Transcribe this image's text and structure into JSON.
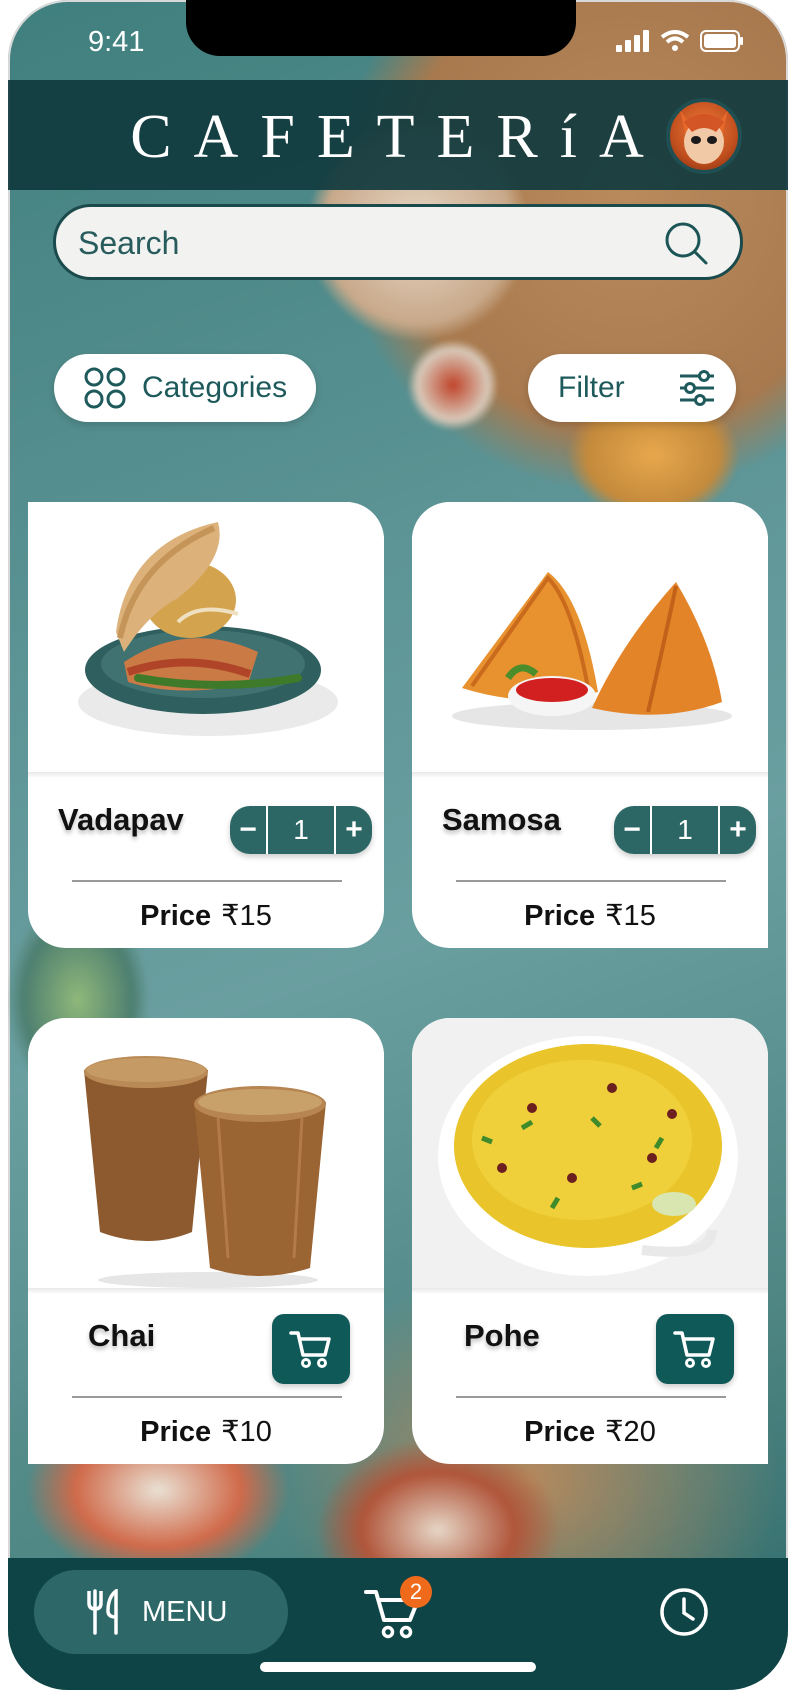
{
  "status_bar": {
    "time": "9:41"
  },
  "header": {
    "title": "CAFETERíA",
    "avatar_icon": "fox-avatar-icon"
  },
  "search": {
    "placeholder": "Search",
    "value": ""
  },
  "controls": {
    "categories_label": "Categories",
    "filter_label": "Filter"
  },
  "items": [
    {
      "name": "Vadapav",
      "price_label": "Price",
      "price": "₹15",
      "quantity": "1",
      "minus": "−",
      "plus": "+",
      "image_icon": "vadapav-image"
    },
    {
      "name": "Samosa",
      "price_label": "Price",
      "price": "₹15",
      "quantity": "1",
      "minus": "−",
      "plus": "+",
      "image_icon": "samosa-image"
    },
    {
      "name": "Chai",
      "price_label": "Price",
      "price": "₹10",
      "action_icon": "cart-icon",
      "image_icon": "chai-image"
    },
    {
      "name": "Pohe",
      "price_label": "Price",
      "price": "₹20",
      "action_icon": "cart-icon",
      "image_icon": "pohe-image"
    }
  ],
  "bottom_nav": {
    "menu_label": "MENU",
    "cart_count": "2",
    "history_icon": "clock-icon"
  },
  "colors": {
    "primary": "#0e4446",
    "accent": "#2c6766",
    "badge": "#f06a1b"
  }
}
